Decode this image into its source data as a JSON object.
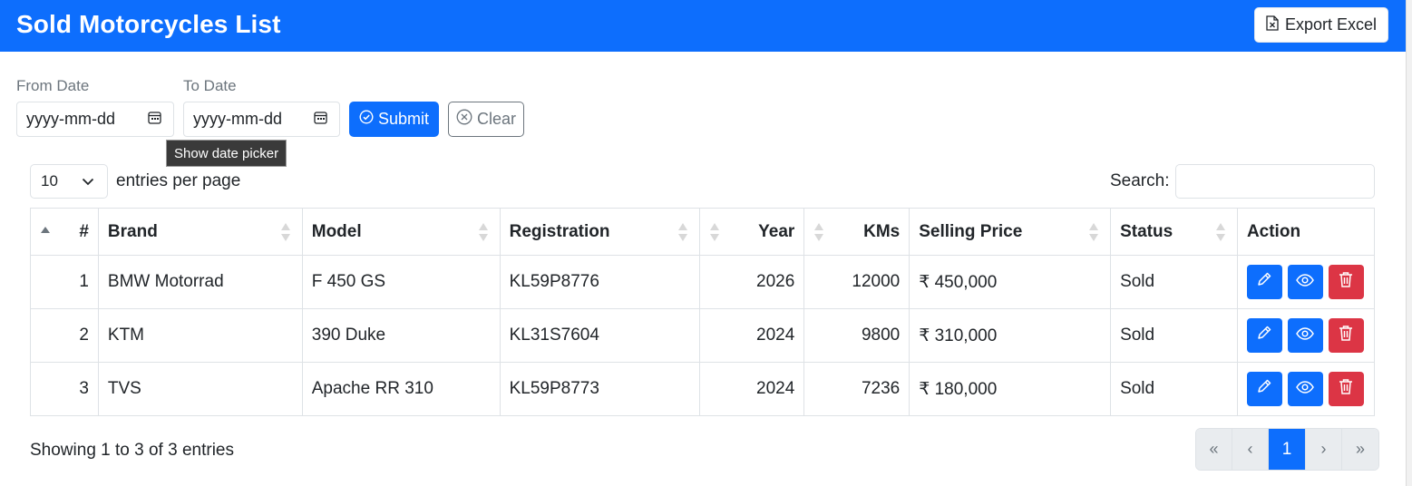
{
  "header": {
    "title": "Sold Motorcycles List",
    "export_label": "Export Excel"
  },
  "filters": {
    "from_label": "From Date",
    "to_label": "To Date",
    "from_placeholder": "yyyy-mm-dd",
    "to_placeholder": "yyyy-mm-dd",
    "submit_label": "Submit",
    "clear_label": "Clear",
    "tooltip": "Show date picker"
  },
  "table_controls": {
    "entries_value": "10",
    "entries_label": "entries per page",
    "search_label": "Search:"
  },
  "table": {
    "headers": [
      "#",
      "Brand",
      "Model",
      "Registration",
      "Year",
      "KMs",
      "Selling Price",
      "Status",
      "Action"
    ],
    "rows": [
      {
        "no": "1",
        "brand": "BMW Motorrad",
        "model": "F 450 GS",
        "registration": "KL59P8776",
        "year": "2026",
        "kms": "12000",
        "price": "₹ 450,000",
        "status": "Sold"
      },
      {
        "no": "2",
        "brand": "KTM",
        "model": "390 Duke",
        "registration": "KL31S7604",
        "year": "2024",
        "kms": "9800",
        "price": "₹ 310,000",
        "status": "Sold"
      },
      {
        "no": "3",
        "brand": "TVS",
        "model": "Apache RR 310",
        "registration": "KL59P8773",
        "year": "2024",
        "kms": "7236",
        "price": "₹ 180,000",
        "status": "Sold"
      }
    ]
  },
  "footer": {
    "info": "Showing 1 to 3 of 3 entries",
    "pager": {
      "first": "«",
      "prev": "‹",
      "current": "1",
      "next": "›",
      "last": "»"
    }
  },
  "colors": {
    "primary": "#0d6efd",
    "danger": "#dc3545",
    "secondary": "#6c757d"
  }
}
